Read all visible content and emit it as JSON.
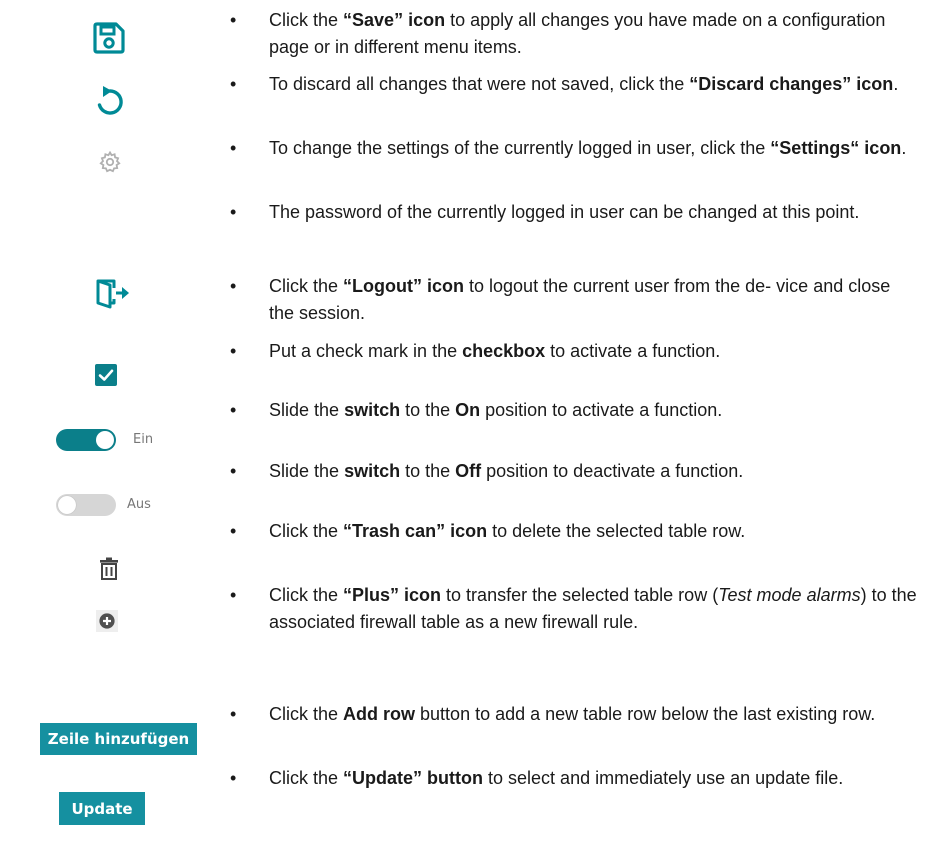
{
  "icons": {
    "save": "save-icon",
    "discard": "discard-changes-icon",
    "settings": "settings-gear-icon",
    "logout": "logout-icon",
    "checkbox": "checkbox-checked-icon",
    "trash": "trash-can-icon",
    "plus": "plus-circle-icon"
  },
  "colors": {
    "accent": "#0b7f8a",
    "button": "#1590a0",
    "muted": "#b0b0b0"
  },
  "switches": {
    "on_label": "Ein",
    "off_label": "Aus",
    "on_state": true,
    "off_state": false
  },
  "buttons": {
    "add_row": "Zeile hinzufügen",
    "update": "Update"
  },
  "bullet_symbol": "•",
  "items": [
    {
      "pre": "Click the ",
      "b1": "“Save” icon",
      "mid": " to apply all changes you have made on a configuration page or in different menu items."
    },
    {
      "pre": "To discard all changes that were not saved, click the ",
      "b1": "“Discard changes” icon",
      "mid": "."
    },
    {
      "pre": "To change the settings of the currently logged in user, click the ",
      "b1": "“Settings“ icon",
      "mid": "."
    },
    {
      "pre": "The password of the currently logged in user can be changed at this point."
    },
    {
      "pre": "Click the ",
      "b1": "“Logout” icon",
      "mid": " to logout the current user from the de- vice and close the session."
    },
    {
      "pre": "Put a check mark in the ",
      "b1": "checkbox",
      "mid": " to activate a function."
    },
    {
      "pre": "Slide the ",
      "b1": "switch",
      "mid": " to the ",
      "b2": "On",
      "post": " position to activate a function."
    },
    {
      "pre": "Slide the ",
      "b1": "switch",
      "mid": " to the ",
      "b2": "Off",
      "post": " position to deactivate a function."
    },
    {
      "pre": "Click the ",
      "b1": "“Trash can” icon",
      "mid": " to delete the selected table row."
    },
    {
      "pre": "Click the ",
      "b1": "“Plus” icon",
      "mid": " to transfer the selected table row (",
      "i1": "Test mode alarms",
      "post": ") to the associated firewall table as a new firewall rule."
    },
    {
      "pre": "Click the ",
      "b1": "Add row",
      "mid": " button to add a new table row below the last existing row."
    },
    {
      "pre": "Click the ",
      "b1": "“Update” button",
      "mid": " to select and immediately use an update file."
    }
  ]
}
